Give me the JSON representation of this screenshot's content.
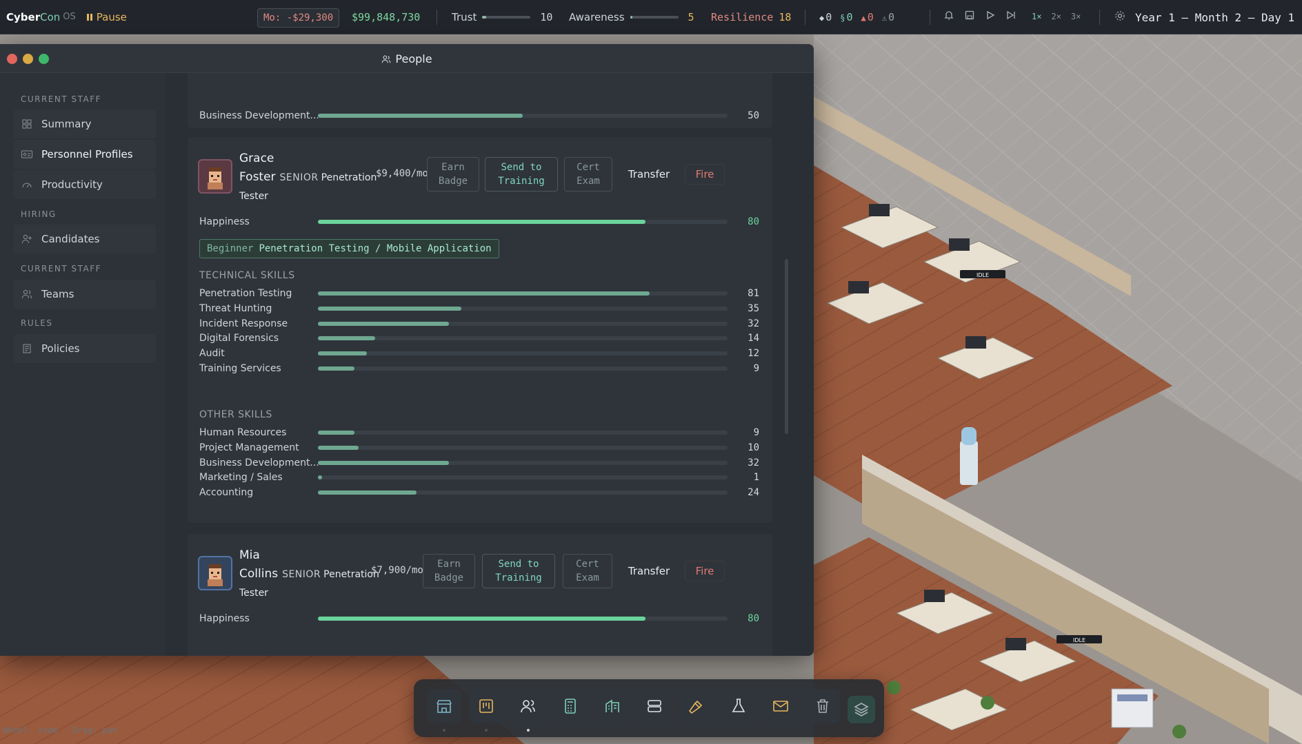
{
  "topbar": {
    "brand_main": "Cyber",
    "brand_accent": "Con",
    "brand_os": "OS",
    "pause_label": "Pause",
    "monthly": "Mo: -$29,300",
    "cash": "$99,848,730",
    "trust_label": "Trust",
    "trust_value": "10",
    "awareness_label": "Awareness",
    "awareness_value": "5",
    "resilience_label": "Resilience",
    "resilience_value": "18",
    "counters": [
      "0",
      "0",
      "0",
      "0"
    ],
    "speeds": [
      "1×",
      "2×",
      "3×"
    ],
    "date": "Year 1 — Month 2 — Day 1"
  },
  "colors": {
    "accent": "#7fd0b4",
    "warning": "#e7b75d",
    "danger": "#e07a72",
    "positive": "#6ad49b"
  },
  "modal": {
    "title": "People",
    "sidebar": {
      "sections": [
        "CURRENT STAFF",
        "HIRING",
        "CURRENT STAFF",
        "RULES"
      ],
      "items": [
        "Summary",
        "Personnel Profiles",
        "Productivity",
        "Candidates",
        "Teams",
        "Policies"
      ]
    }
  },
  "prev_card": {
    "skill_name": "Business Development...",
    "skill_value": 50
  },
  "people": [
    {
      "first": "Grace",
      "last": "Foster",
      "rank": "SENIOR",
      "role_a": "Penetration",
      "role_b": "Tester",
      "salary": "$9,400/mo",
      "buttons": {
        "badge": "Earn Badge",
        "training": "Send to Training",
        "exam": "Cert Exam",
        "transfer": "Transfer",
        "fire": "Fire"
      },
      "happiness_label": "Happiness",
      "happiness": 80,
      "cert_level": "Beginner",
      "cert_name": "Penetration Testing / Mobile Application",
      "technical_header": "TECHNICAL SKILLS",
      "technical": [
        {
          "name": "Penetration Testing",
          "value": 81
        },
        {
          "name": "Threat Hunting",
          "value": 35
        },
        {
          "name": "Incident Response",
          "value": 32
        },
        {
          "name": "Digital Forensics",
          "value": 14
        },
        {
          "name": "Audit",
          "value": 12
        },
        {
          "name": "Training Services",
          "value": 9
        }
      ],
      "other_header": "OTHER SKILLS",
      "other": [
        {
          "name": "Human Resources",
          "value": 9
        },
        {
          "name": "Project Management",
          "value": 10
        },
        {
          "name": "Business Development...",
          "value": 32
        },
        {
          "name": "Marketing / Sales",
          "value": 1
        },
        {
          "name": "Accounting",
          "value": 24
        }
      ]
    },
    {
      "first": "Mia",
      "last": "Collins",
      "rank": "SENIOR",
      "role_a": "Penetration",
      "role_b": "Tester",
      "salary": "$7,900/mo",
      "buttons": {
        "badge": "Earn Badge",
        "training": "Send to Training",
        "exam": "Cert Exam",
        "transfer": "Transfer",
        "fire": "Fire"
      },
      "happiness_label": "Happiness",
      "happiness": 80
    }
  ],
  "dock": {
    "icons": [
      "store-icon",
      "board-icon",
      "people-icon",
      "calculator-icon",
      "building-icon",
      "server-icon",
      "hammer-icon",
      "flask-icon",
      "mail-icon",
      "trash-icon",
      "layers-icon"
    ],
    "active_index": 2
  },
  "hint": "Wheel: zoom · Drag: pan",
  "scene_labels": [
    "IDLE",
    "IDLE"
  ]
}
